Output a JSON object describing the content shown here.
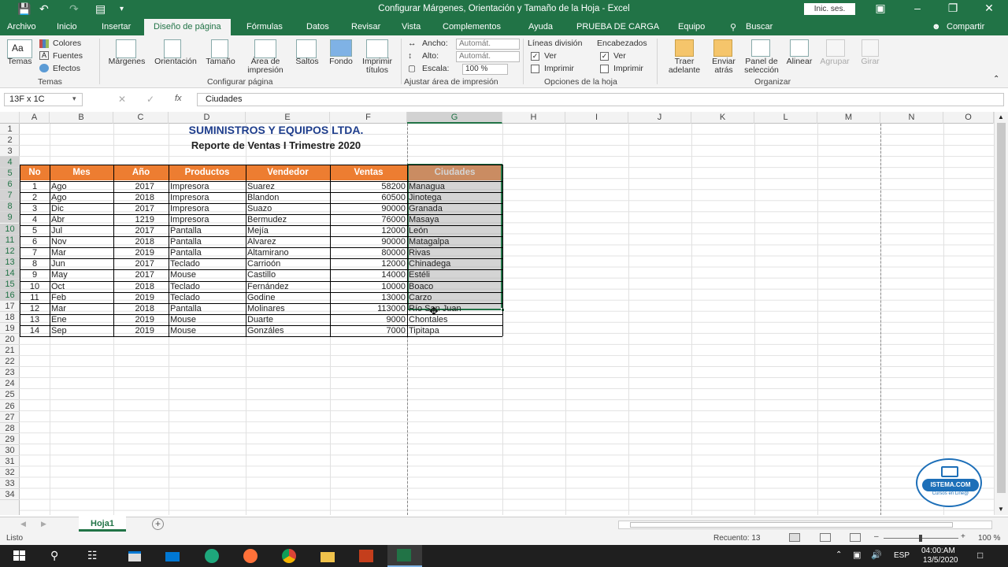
{
  "titlebar": {
    "title": "Configurar Márgenes, Orientación y Tamaño de la Hoja  -  Excel",
    "signin": "Inic. ses."
  },
  "tabs": [
    "Archivo",
    "Inicio",
    "Insertar",
    "Diseño de página",
    "Fórmulas",
    "Datos",
    "Revisar",
    "Vista",
    "Complementos",
    "Ayuda",
    "PRUEBA DE CARGA",
    "Equipo",
    "Buscar"
  ],
  "share": "Compartir",
  "ribbon": {
    "temas": {
      "themes": "Temas",
      "colores": "Colores",
      "fuentes": "Fuentes",
      "efectos": "Efectos",
      "group": "Temas"
    },
    "config": {
      "margenes": "Márgenes",
      "orientacion": "Orientación",
      "tamano": "Tamaño",
      "area1": "Área de",
      "area2": "impresión",
      "saltos": "Saltos",
      "fondo": "Fondo",
      "imp1": "Imprimir",
      "imp2": "títulos",
      "group": "Configurar página"
    },
    "ajustar": {
      "ancho": "Ancho:",
      "alto": "Alto:",
      "escala": "Escala:",
      "ancho_val": "Automát.",
      "alto_val": "Automát.",
      "escala_val": "100 %",
      "group": "Ajustar área de impresión"
    },
    "opciones": {
      "lineas": "Líneas división",
      "encabezados": "Encabezados",
      "ver1": "Ver",
      "ver2": "Ver",
      "imprimir1": "Imprimir",
      "imprimir2": "Imprimir",
      "group": "Opciones de la hoja"
    },
    "organizar": {
      "traer1": "Traer",
      "traer2": "adelante",
      "enviar1": "Enviar",
      "enviar2": "atrás",
      "panel1": "Panel de",
      "panel2": "selección",
      "alinear": "Alinear",
      "agrupar": "Agrupar",
      "girar": "Girar",
      "group": "Organizar"
    }
  },
  "formula": {
    "namebox": "13F x 1C",
    "fx": "fx",
    "value": "Ciudades"
  },
  "columns": [
    "A",
    "B",
    "C",
    "D",
    "E",
    "F",
    "G",
    "H",
    "I",
    "J",
    "K",
    "L",
    "M",
    "N",
    "O"
  ],
  "rows": [
    "1",
    "2",
    "3",
    "4",
    "5",
    "6",
    "7",
    "8",
    "9",
    "10",
    "11",
    "12",
    "13",
    "14",
    "15",
    "16",
    "17",
    "18",
    "19",
    "20",
    "21",
    "22",
    "23",
    "24",
    "25",
    "26",
    "27",
    "28",
    "29",
    "30",
    "31",
    "32",
    "33",
    "34"
  ],
  "sheet": {
    "title1": "SUMINISTROS Y EQUIPOS LTDA.",
    "title2": "Reporte de Ventas I Trimestre 2020",
    "headers": [
      "No",
      "Mes",
      "Año",
      "Productos",
      "Vendedor",
      "Ventas",
      "Ciudades"
    ],
    "data": [
      [
        "1",
        "Ago",
        "2017",
        "Impresora",
        "Suarez",
        "58200",
        "Managua"
      ],
      [
        "2",
        "Ago",
        "2018",
        "Impresora",
        "Blandon",
        "60500",
        "Jinotega"
      ],
      [
        "3",
        "Dic",
        "2017",
        "Impresora",
        "Suazo",
        "90000",
        "Granada"
      ],
      [
        "4",
        "Abr",
        "1219",
        "Impresora",
        "Bermudez",
        "76000",
        "Masaya"
      ],
      [
        "5",
        "Jul",
        "2017",
        "Pantalla",
        "Mejía",
        "12000",
        "León"
      ],
      [
        "6",
        "Nov",
        "2018",
        "Pantalla",
        "Alvarez",
        "90000",
        "Matagalpa"
      ],
      [
        "7",
        "Mar",
        "2019",
        "Pantalla",
        "Altamirano",
        "80000",
        "Rivas"
      ],
      [
        "8",
        "Jun",
        "2017",
        "Teclado",
        "Carrioón",
        "12000",
        "Chinadega"
      ],
      [
        "9",
        "May",
        "2017",
        "Mouse",
        "Castillo",
        "14000",
        "Estéli"
      ],
      [
        "10",
        "Oct",
        "2018",
        "Teclado",
        "Fernández",
        "10000",
        "Boaco"
      ],
      [
        "11",
        "Feb",
        "2019",
        "Teclado",
        "Godine",
        "13000",
        "Carzo"
      ],
      [
        "12",
        "Mar",
        "2018",
        "Pantalla",
        "Molinares",
        "113000",
        "Río San Juan"
      ],
      [
        "13",
        "Ene",
        "2019",
        "Mouse",
        "Duarte",
        "9000",
        "Chontales"
      ],
      [
        "14",
        "Sep",
        "2019",
        "Mouse",
        "Gonzáles",
        "7000",
        "Tipitapa"
      ]
    ]
  },
  "sheettab": "Hoja1",
  "status": {
    "ready": "Listo",
    "count": "Recuento: 13",
    "zoom": "100 %"
  },
  "taskbar": {
    "lang": "ESP",
    "time": "04:00:AM",
    "date": "13/5/2020"
  },
  "logo": {
    "line1": "ISTEMA.COM",
    "line2": "Cursos en Line@"
  }
}
